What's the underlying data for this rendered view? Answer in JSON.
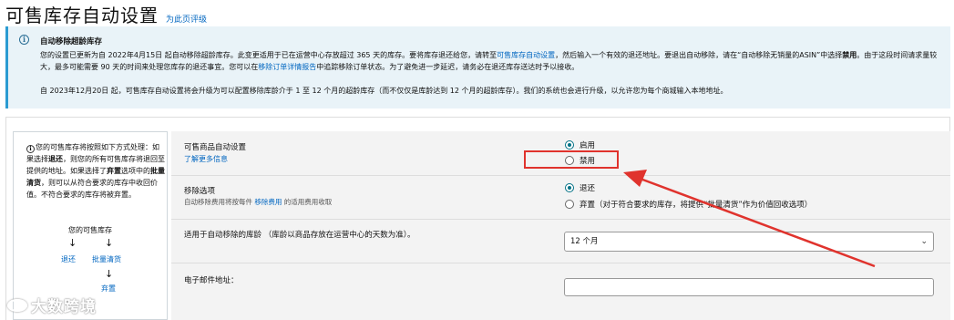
{
  "header": {
    "title": "可售库存自动设置",
    "rate_link": "为此页评级"
  },
  "info": {
    "title": "自动移除超龄库存",
    "p1_a": "您的设置已更新为自 2022年4月15日 起自动移除超龄库存。此变更适用于已在运营中心存放超过 365 天的库存。要将库存退还给您，请转至",
    "p1_link1": "可售库存自动设置",
    "p1_b": "，然后输入一个有效的退还地址。要退出自动移除，请在“自动移除无销量的ASIN”中选择",
    "p1_bold": "禁用",
    "p1_c": "。由于这段时间请求量较大，最多可能需要 90 天的时间来处理您库存的退还事宜。您可以在",
    "p1_link2": "移除订单详情报告",
    "p1_d": "中追踪移除订单状态。为了避免进一步延迟，请务必在退还库存送达时予以接收。",
    "p2": "自 2023年12月20日 起，可售库存自动设置将会升级为可以配置移除库龄介于 1 至 12 个月的超龄库存（而不仅仅是库龄达到 12 个月的超龄库存）。我们的系统也会进行升级，以允许您为每个商城输入本地地址。"
  },
  "side": {
    "t1": "您的可售库存将按照如下方式处理：如果选择",
    "b1": "退还",
    "t2": "，则您的所有可售库存将退回至提供的地址。如果选择了",
    "b2": "弃置",
    "t3": "选项中的",
    "b3": "批量清货",
    "t4": "，则可以从符合要求的库存中收回价值。不符合要求的库存将被弃置。",
    "flow_top": "您的可售库存",
    "flow_return": "退还",
    "flow_liquidate": "批量清货",
    "flow_dispose": "弃置"
  },
  "rows": {
    "auto": {
      "label": "可售商品自动设置",
      "link": "了解更多信息",
      "opt_enable": "启用",
      "opt_disable": "禁用",
      "selected": "启用"
    },
    "removal": {
      "label": "移除选项",
      "sub_a": "自动移除费用将按每件",
      "sub_link": "移除费用",
      "sub_b": "的适用费用收取",
      "opt_return": "退还",
      "opt_dispose": "弃置（对于符合要求的库存，将提供“批量清货”作为价值回收选项）",
      "selected": "退还"
    },
    "age": {
      "label": "适用于自动移除的库龄 （库龄以商品存放在运营中心的天数为准）。",
      "value": "12 个月"
    },
    "email": {
      "label": "电子邮件地址：",
      "value": ""
    }
  },
  "watermark": "大数跨境",
  "colors": {
    "accent": "#007185",
    "link": "#0066c0",
    "annotation": "#e0332d",
    "info_bg": "#e9f3f8"
  }
}
